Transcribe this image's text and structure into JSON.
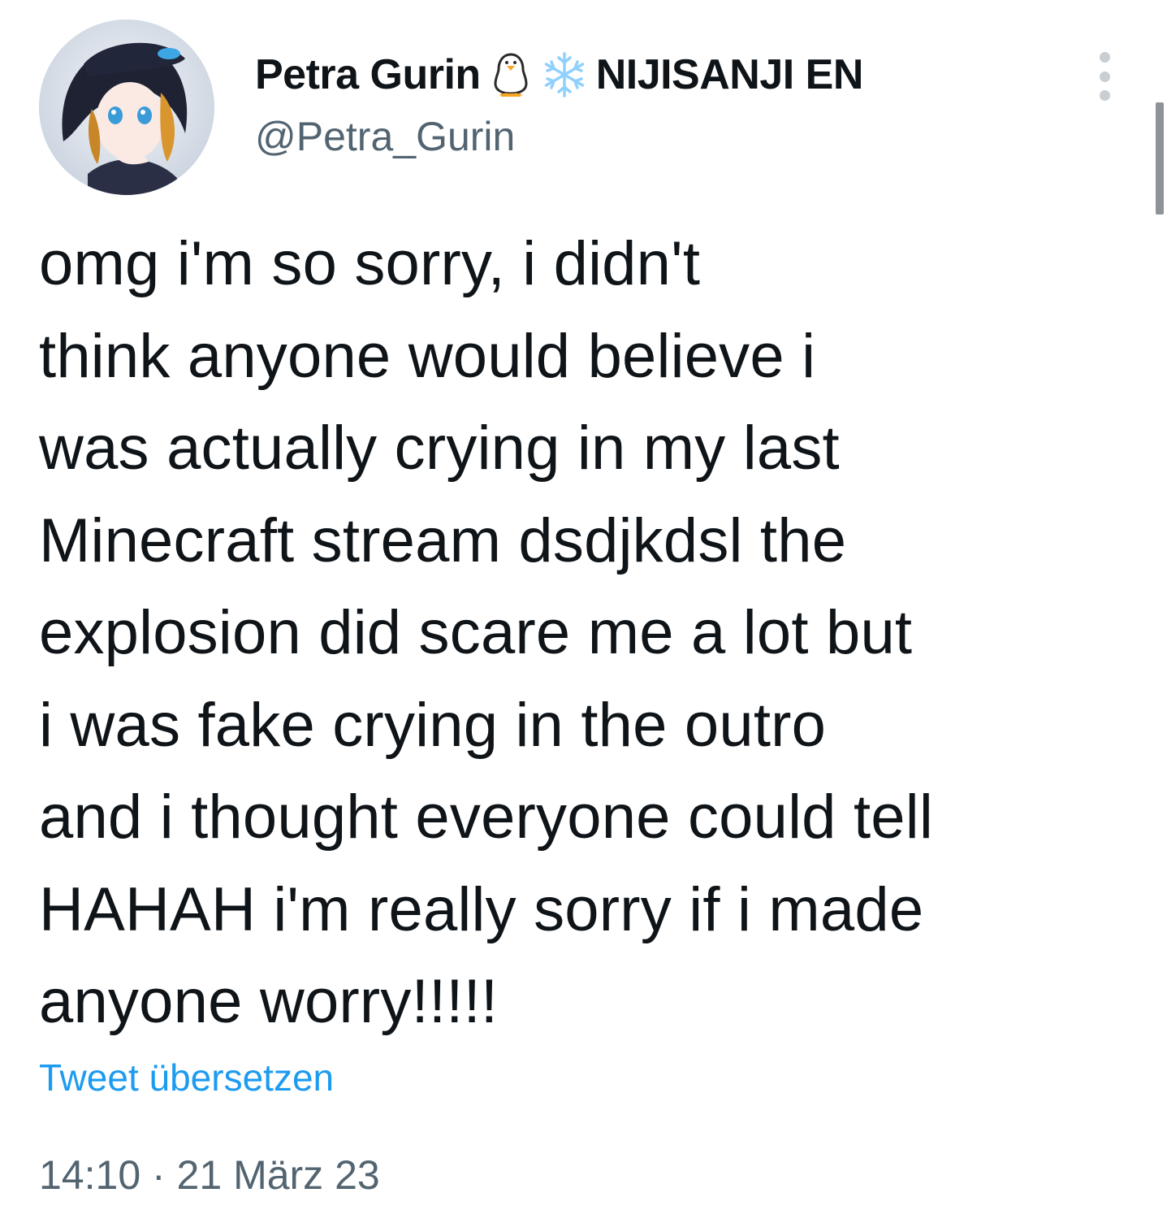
{
  "author": {
    "display_name": "Petra Gurin",
    "emoji_1": "penguin-icon",
    "emoji_2": "snowflake-icon",
    "affiliation": "NIJISANJI EN",
    "handle": "@Petra_Gurin"
  },
  "tweet": {
    "text": "omg i'm so sorry, i didn't\nthink anyone would believe i\nwas actually crying in my last\nMinecraft stream dsdjkdsl the\nexplosion did scare me a lot but\ni was fake crying in the outro\nand i thought everyone could tell\nHAHAH i'm really sorry if i made\nanyone worry!!!!!",
    "translate_label": "Tweet übersetzen",
    "timestamp": "14:10 · 21 März 23"
  },
  "colors": {
    "text": "#0f1419",
    "secondary": "#536471",
    "link": "#1d9bf0",
    "snowflake": "#8fd0ff"
  },
  "icons": {
    "more": "more-vertical-icon"
  }
}
